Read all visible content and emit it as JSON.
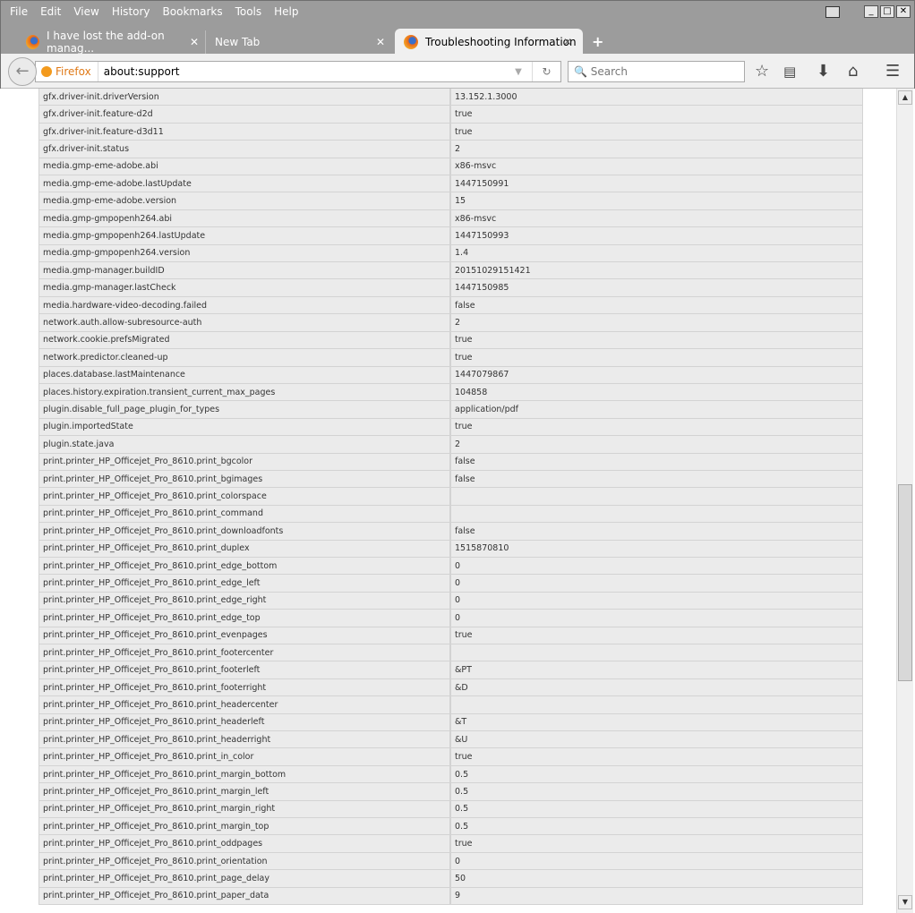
{
  "menu": [
    "File",
    "Edit",
    "View",
    "History",
    "Bookmarks",
    "Tools",
    "Help"
  ],
  "tabs": [
    {
      "label": "I have lost the add-on manag..."
    },
    {
      "label": "New Tab"
    },
    {
      "label": "Troubleshooting Information"
    }
  ],
  "urlbar": {
    "identity": "Firefox",
    "url": "about:support"
  },
  "search": {
    "placeholder": "Search"
  },
  "prefs": [
    [
      "gfx.driver-init.driverVersion",
      "13.152.1.3000"
    ],
    [
      "gfx.driver-init.feature-d2d",
      "true"
    ],
    [
      "gfx.driver-init.feature-d3d11",
      "true"
    ],
    [
      "gfx.driver-init.status",
      "2"
    ],
    [
      "media.gmp-eme-adobe.abi",
      "x86-msvc"
    ],
    [
      "media.gmp-eme-adobe.lastUpdate",
      "1447150991"
    ],
    [
      "media.gmp-eme-adobe.version",
      "15"
    ],
    [
      "media.gmp-gmpopenh264.abi",
      "x86-msvc"
    ],
    [
      "media.gmp-gmpopenh264.lastUpdate",
      "1447150993"
    ],
    [
      "media.gmp-gmpopenh264.version",
      "1.4"
    ],
    [
      "media.gmp-manager.buildID",
      "20151029151421"
    ],
    [
      "media.gmp-manager.lastCheck",
      "1447150985"
    ],
    [
      "media.hardware-video-decoding.failed",
      "false"
    ],
    [
      "network.auth.allow-subresource-auth",
      "2"
    ],
    [
      "network.cookie.prefsMigrated",
      "true"
    ],
    [
      "network.predictor.cleaned-up",
      "true"
    ],
    [
      "places.database.lastMaintenance",
      "1447079867"
    ],
    [
      "places.history.expiration.transient_current_max_pages",
      "104858"
    ],
    [
      "plugin.disable_full_page_plugin_for_types",
      "application/pdf"
    ],
    [
      "plugin.importedState",
      "true"
    ],
    [
      "plugin.state.java",
      "2"
    ],
    [
      "print.printer_HP_Officejet_Pro_8610.print_bgcolor",
      "false"
    ],
    [
      "print.printer_HP_Officejet_Pro_8610.print_bgimages",
      "false"
    ],
    [
      "print.printer_HP_Officejet_Pro_8610.print_colorspace",
      ""
    ],
    [
      "print.printer_HP_Officejet_Pro_8610.print_command",
      ""
    ],
    [
      "print.printer_HP_Officejet_Pro_8610.print_downloadfonts",
      "false"
    ],
    [
      "print.printer_HP_Officejet_Pro_8610.print_duplex",
      "1515870810"
    ],
    [
      "print.printer_HP_Officejet_Pro_8610.print_edge_bottom",
      "0"
    ],
    [
      "print.printer_HP_Officejet_Pro_8610.print_edge_left",
      "0"
    ],
    [
      "print.printer_HP_Officejet_Pro_8610.print_edge_right",
      "0"
    ],
    [
      "print.printer_HP_Officejet_Pro_8610.print_edge_top",
      "0"
    ],
    [
      "print.printer_HP_Officejet_Pro_8610.print_evenpages",
      "true"
    ],
    [
      "print.printer_HP_Officejet_Pro_8610.print_footercenter",
      ""
    ],
    [
      "print.printer_HP_Officejet_Pro_8610.print_footerleft",
      "&PT"
    ],
    [
      "print.printer_HP_Officejet_Pro_8610.print_footerright",
      "&D"
    ],
    [
      "print.printer_HP_Officejet_Pro_8610.print_headercenter",
      ""
    ],
    [
      "print.printer_HP_Officejet_Pro_8610.print_headerleft",
      "&T"
    ],
    [
      "print.printer_HP_Officejet_Pro_8610.print_headerright",
      "&U"
    ],
    [
      "print.printer_HP_Officejet_Pro_8610.print_in_color",
      "true"
    ],
    [
      "print.printer_HP_Officejet_Pro_8610.print_margin_bottom",
      "0.5"
    ],
    [
      "print.printer_HP_Officejet_Pro_8610.print_margin_left",
      "0.5"
    ],
    [
      "print.printer_HP_Officejet_Pro_8610.print_margin_right",
      "0.5"
    ],
    [
      "print.printer_HP_Officejet_Pro_8610.print_margin_top",
      "0.5"
    ],
    [
      "print.printer_HP_Officejet_Pro_8610.print_oddpages",
      "true"
    ],
    [
      "print.printer_HP_Officejet_Pro_8610.print_orientation",
      "0"
    ],
    [
      "print.printer_HP_Officejet_Pro_8610.print_page_delay",
      "50"
    ],
    [
      "print.printer_HP_Officejet_Pro_8610.print_paper_data",
      "9"
    ]
  ]
}
